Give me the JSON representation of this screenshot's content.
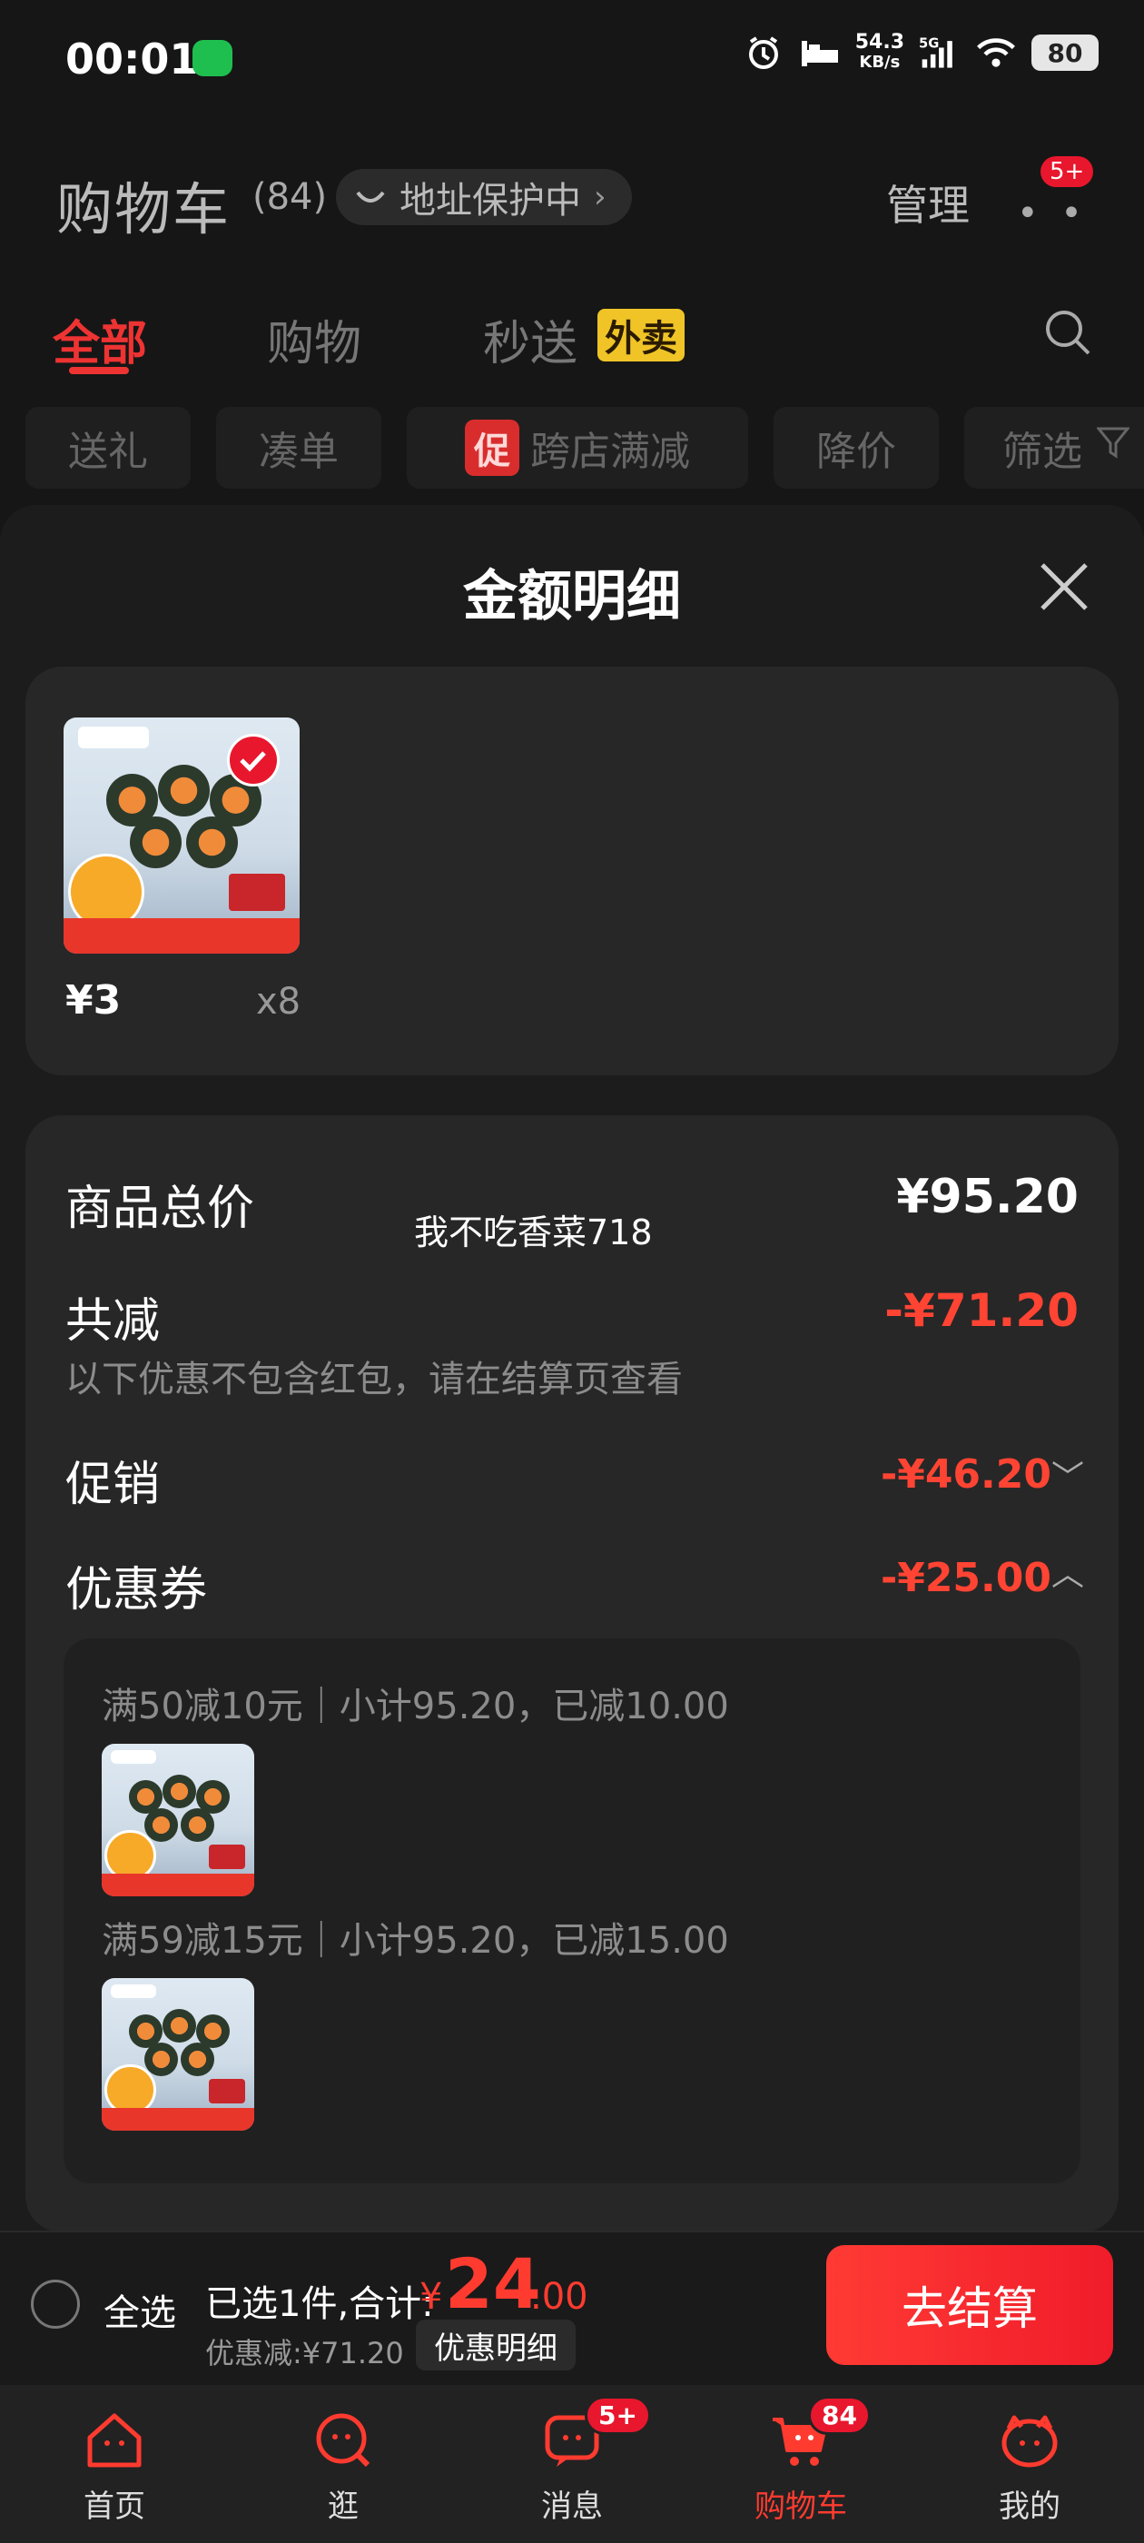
{
  "status_bar": {
    "time": "00:01",
    "net_speed_value": "54.3",
    "net_speed_unit": "KB/s",
    "signal": "5G",
    "battery": "80"
  },
  "header": {
    "title": "购物车",
    "count": "(84)",
    "address_label": "地址保护中",
    "manage_label": "管理",
    "more_badge": "5+"
  },
  "tabs": [
    {
      "label": "全部"
    },
    {
      "label": "购物"
    },
    {
      "label": "秒送",
      "badge": "外卖"
    }
  ],
  "filter_chips": [
    {
      "label": "送礼"
    },
    {
      "label": "凑单"
    },
    {
      "tag": "促",
      "label": "跨店满减"
    },
    {
      "label": "降价"
    },
    {
      "label": "筛选"
    }
  ],
  "sheet": {
    "title": "金额明细",
    "product": {
      "price": "¥3",
      "qty": "x8"
    },
    "summary": {
      "total_label": "商品总价",
      "total_value": "¥95.20",
      "discount_label": "共减",
      "discount_value": "-¥71.20",
      "discount_note": "以下优惠不包含红包，请在结算页查看",
      "promo_label": "促销",
      "promo_value": "-¥46.20",
      "coupon_label": "优惠券",
      "coupon_value": "-¥25.00"
    },
    "coupons": [
      {
        "text": "满50减10元｜小计95.20，已减10.00"
      },
      {
        "text": "满59减15元｜小计95.20，已减15.00"
      }
    ],
    "watermark": "我不吃香菜718"
  },
  "checkout": {
    "select_all": "全选",
    "selected_text": "已选1件,合计:",
    "currency": "¥",
    "amount_int": "24",
    "amount_dec": ".00",
    "saved_text": "优惠减:¥71.20",
    "detail_button": "优惠明细",
    "checkout_button": "去结算"
  },
  "bottom_nav": [
    {
      "label": "首页",
      "icon": "home-icon"
    },
    {
      "label": "逛",
      "icon": "browse-icon"
    },
    {
      "label": "消息",
      "icon": "message-icon",
      "badge": "5+"
    },
    {
      "label": "购物车",
      "icon": "cart-icon",
      "badge": "84",
      "active": true
    },
    {
      "label": "我的",
      "icon": "profile-icon"
    }
  ],
  "colors": {
    "accent_red": "#ff3b30",
    "badge_yellow": "#f0c427",
    "background": "#161616"
  }
}
